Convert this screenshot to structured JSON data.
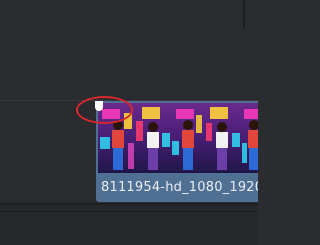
{
  "timeline": {
    "clip": {
      "name": "8111954-hd_1080_1920",
      "color": "#4f6f93",
      "thumbnail_icon": "video-thumbnail-icon"
    },
    "in_marker_icon": "clip-handle-icon",
    "annotation_color": "#d8282c"
  }
}
